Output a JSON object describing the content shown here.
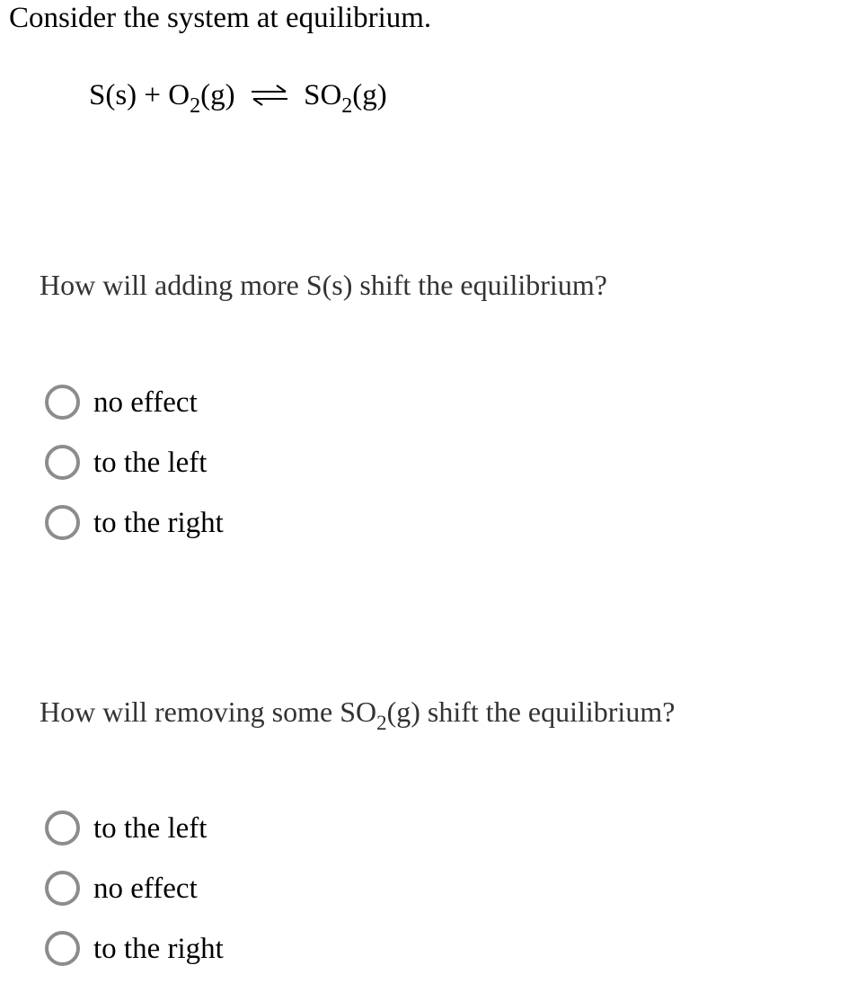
{
  "intro": "Consider the system at equilibrium.",
  "equation": {
    "reactant1": "S(s) + O",
    "reactant1_sub": "2",
    "reactant1_state": "(g)",
    "arrow_icon": "equilibrium-arrows",
    "product": "SO",
    "product_sub": "2",
    "product_state": "(g)"
  },
  "questions": [
    {
      "text": "How will adding more S(s) shift the equilibrium?",
      "options": [
        {
          "label": "no effect",
          "selected": false
        },
        {
          "label": "to the left",
          "selected": false
        },
        {
          "label": "to the right",
          "selected": false
        }
      ]
    },
    {
      "text_before": "How will removing some SO",
      "text_sub": "2",
      "text_after": "(g) shift the equilibrium?",
      "options": [
        {
          "label": "to the left",
          "selected": false
        },
        {
          "label": "no effect",
          "selected": false
        },
        {
          "label": "to the right",
          "selected": false
        }
      ]
    }
  ],
  "colors": {
    "radio_border": "#8c8c8c",
    "question_text": "#333333",
    "body_text": "#000000"
  }
}
